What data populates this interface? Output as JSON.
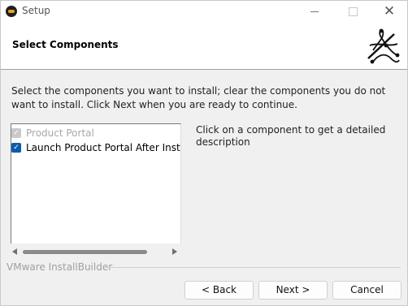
{
  "window": {
    "title": "Setup"
  },
  "title_bar": {
    "icons": [
      "app-icon",
      "minimize-icon",
      "maximize-icon",
      "close-icon"
    ],
    "close_glyph": "✕"
  },
  "header": {
    "title": "Select Components",
    "logo_icon": "installer-logo-icon"
  },
  "instructions": "Select the components you want to install; clear the components you do not want to install. Click Next when you are ready to continue.",
  "components": [
    {
      "label": "Product Portal",
      "checked": true,
      "disabled": true
    },
    {
      "label": "Launch Product Portal After Installation",
      "checked": true,
      "disabled": false
    }
  ],
  "description": "Click on a component to get a detailed description",
  "footer": {
    "brand": "VMware InstallBuilder",
    "buttons": {
      "back": "< Back",
      "next": "Next >",
      "cancel": "Cancel"
    }
  },
  "colors": {
    "checkbox_checked": "#0b5cab",
    "checkbox_disabled": "#c9c9c9",
    "window_bg": "#f0f0f0"
  }
}
